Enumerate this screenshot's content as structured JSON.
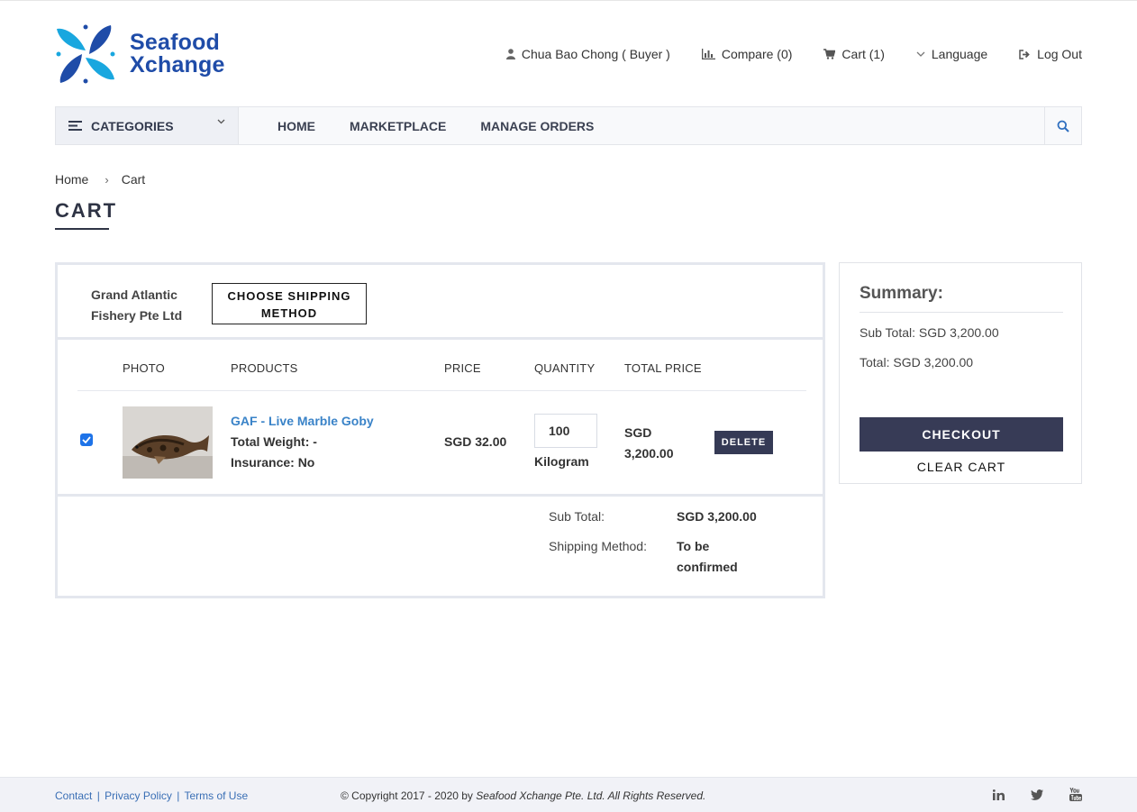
{
  "header": {
    "logo": {
      "line1": "Seafood",
      "line2": "Xchange"
    },
    "user_label": "Chua Bao Chong ( Buyer )",
    "compare_label": "Compare (0)",
    "cart_label": "Cart (1)",
    "language_label": "Language",
    "logout_label": "Log Out"
  },
  "nav": {
    "categories_label": "CATEGORIES",
    "items": [
      "HOME",
      "MARKETPLACE",
      "MANAGE ORDERS"
    ]
  },
  "breadcrumb": {
    "home": "Home",
    "separator": "›",
    "current": "Cart"
  },
  "page_title": "CART",
  "cart": {
    "seller": "Grand Atlantic Fishery Pte Ltd",
    "shipping_button": "CHOOSE SHIPPING METHOD",
    "columns": {
      "photo": "PHOTO",
      "products": "PRODUCTS",
      "price": "PRICE",
      "quantity": "QUANTITY",
      "total_price": "TOTAL PRICE"
    },
    "item": {
      "checked": true,
      "name": "GAF - Live Marble Goby",
      "weight": "Total Weight: -",
      "insurance": "Insurance: No",
      "price": "SGD 32.00",
      "quantity": "100",
      "unit": "Kilogram",
      "total": "SGD 3,200.00",
      "delete_label": "DELETE"
    },
    "subtotal_label": "Sub Total:",
    "subtotal_value": "SGD 3,200.00",
    "shipping_label": "Shipping Method:",
    "shipping_value": "To be confirmed"
  },
  "summary": {
    "title": "Summary:",
    "sub_total": "Sub Total: SGD 3,200.00",
    "total": "Total: SGD 3,200.00",
    "checkout_label": "CHECKOUT",
    "clear_label": "CLEAR CART"
  },
  "footer": {
    "contact": "Contact",
    "privacy": "Privacy Policy",
    "terms": "Terms of Use",
    "pipe": "|",
    "copyright_prefix": "© Copyright 2017 - 2020 by",
    "copyright_company": "Seafood Xchange Pte. Ltd. All Rights Reserved.",
    "social_icons": [
      "linkedin-icon",
      "twitter-icon",
      "youtube-icon"
    ]
  },
  "colors": {
    "brand_blue": "#1f4ca8",
    "logo_accent": "#19a7df",
    "link_blue": "#3a83c8",
    "dark_button": "#373b56",
    "checkbox": "#1e73e8"
  }
}
